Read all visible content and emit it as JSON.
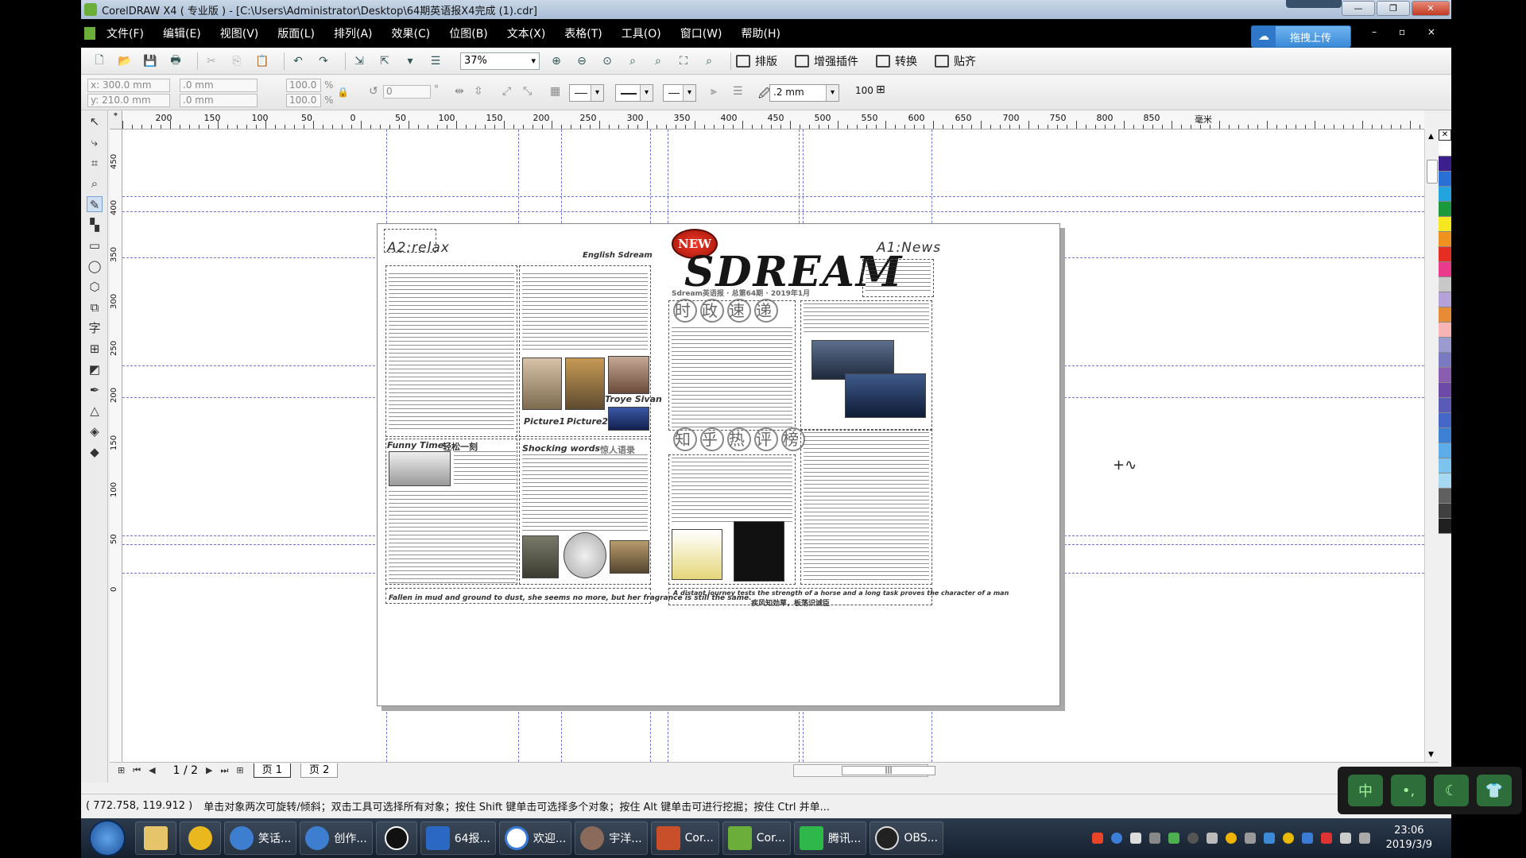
{
  "window": {
    "title": "CorelDRAW X4 ( 专业版 ) - [C:\\Users\\Administrator\\Desktop\\64期英语报X4完成 (1).cdr]",
    "buttons": [
      "—",
      "❐",
      "✕"
    ]
  },
  "menu": [
    "文件(F)",
    "编辑(E)",
    "视图(V)",
    "版面(L)",
    "排列(A)",
    "效果(C)",
    "位图(B)",
    "文本(X)",
    "表格(T)",
    "工具(O)",
    "窗口(W)",
    "帮助(H)"
  ],
  "upload_button": "拖拽上传",
  "toolbar": {
    "zoom": "37%",
    "text_buttons": [
      "排版",
      "增强插件",
      "转换",
      "贴齐"
    ]
  },
  "propbar": {
    "x": "x: 300.0 mm",
    "y": "y: 210.0 mm",
    "w": ".0 mm",
    "h": ".0 mm",
    "scale_x": "100.0",
    "scale_y": "100.0",
    "pct": "%",
    "angle": "0",
    "deg": "°",
    "outline_width": ".2 mm",
    "num": "100"
  },
  "hruler_labels": [
    "200",
    "150",
    "100",
    "50",
    "0",
    "50",
    "100",
    "150",
    "200",
    "250",
    "300",
    "350",
    "400",
    "450",
    "500",
    "550",
    "600",
    "650",
    "700",
    "750",
    "800",
    "850"
  ],
  "hruler_unit": "毫米",
  "vruler_labels": [
    "450",
    "400",
    "350",
    "300",
    "250",
    "200",
    "150",
    "100",
    "50",
    "0"
  ],
  "newspaper": {
    "badge": "NEW",
    "masthead": "SDREAM",
    "a2_label": "A2:relax",
    "a1_label": "A1:News",
    "english_sdream": "English Sdream",
    "troye": "Troye Sivan",
    "picture1": "Picture1",
    "picture2": "Picture2",
    "funny_time": "Funny Time",
    "funny_cn": "轻松一刻",
    "shocking": "Shocking words",
    "shocking_cn": "惊人语录",
    "politics_cn": [
      "时",
      "政",
      "速",
      "递"
    ],
    "hot_cn": [
      "知",
      "乎",
      "热",
      "评",
      "榜"
    ],
    "sdream_line": "Sdream英语报 · 总第64期 · 2019年1月",
    "footer_en": "A distant journey tests the strength of a horse and a long task proves the character of a man",
    "footer_cn": "疾风知劲草，板荡识诚臣",
    "bottom_left_note": "Fallen in mud and ground to dust, she seems no more, but her fragrance is still the same."
  },
  "pagenav": {
    "counter": "1 / 2",
    "tabs": [
      "页 1",
      "页 2"
    ]
  },
  "status": {
    "coords": "( 772.758, 119.912 )",
    "hint": "单击对象两次可旋转/倾斜；双击工具可选择所有对象；按住 Shift 键单击可选择多个对象；按住 Alt 键单击可进行挖掘；按住 Ctrl 并单..."
  },
  "ime": [
    "中",
    "•,",
    "☾",
    "👕"
  ],
  "taskbar": {
    "apps": [
      "笑话...",
      "创作...",
      "64报...",
      "欢迎...",
      "宇洋...",
      "Cor...",
      "Cor...",
      "腾讯...",
      "OBS..."
    ],
    "time": "23:06",
    "date": "2019/3/9"
  },
  "palette_colors": [
    "#ffffff",
    "#3c1e8c",
    "#2a6fd6",
    "#23a4df",
    "#1a9a3c",
    "#f5e821",
    "#f09220",
    "#e52d24",
    "#ea3a8c",
    "#c8c8c8",
    "#b5a2d8",
    "#e88b36",
    "#f7b4b4",
    "#9b9bd0",
    "#7a7ac0",
    "#8a5db0",
    "#6e4aa8",
    "#5a5ab8",
    "#4466c6",
    "#3b80d2",
    "#5dade8",
    "#7cc4ee",
    "#a6d8f2",
    "#606060",
    "#404040",
    "#202020"
  ]
}
